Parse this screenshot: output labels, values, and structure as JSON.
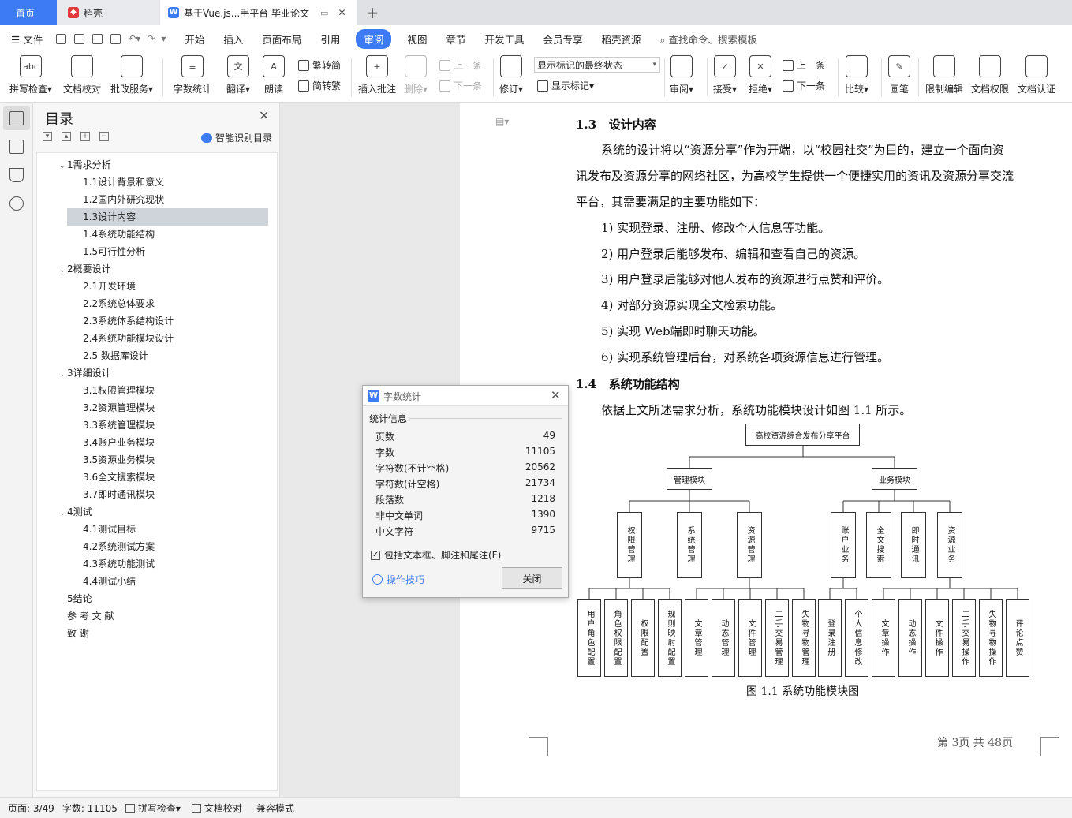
{
  "tabs": {
    "home": "首页",
    "daoke": "稻壳",
    "doc": "基于Vue.js...手平台 毕业论文",
    "add": "+"
  },
  "menu": {
    "file": "文件",
    "items": [
      "开始",
      "插入",
      "页面布局",
      "引用",
      "审阅",
      "视图",
      "章节",
      "开发工具",
      "会员专享",
      "稻壳资源"
    ],
    "active": "审阅",
    "search": "查找命令、搜索模板"
  },
  "ribbon": {
    "spell": "拼写检查",
    "proof": "文档校对",
    "batch": "批改服务",
    "count": "字数统计",
    "translate": "翻译",
    "read": "朗读",
    "to_trad": "繁转简",
    "to_simp": "简转繁",
    "insert_comment": "插入批注",
    "delete": "删除",
    "prev": "上一条",
    "next": "下一条",
    "revise": "修订",
    "markup_select": "显示标记的最终状态",
    "show_markup": "显示标记",
    "review": "审阅",
    "accept": "接受",
    "reject": "拒绝",
    "prev2": "上一条",
    "next2": "下一条",
    "compare": "比较",
    "pen": "画笔",
    "restrict": "限制编辑",
    "permission": "文档权限",
    "certify": "文档认证"
  },
  "nav": {
    "title": "目录",
    "smart": "智能识别目录",
    "items": [
      {
        "label": "1需求分析",
        "level": 1,
        "caret": true
      },
      {
        "label": "1.1设计背景和意义",
        "level": 2
      },
      {
        "label": "1.2国内外研究现状",
        "level": 2
      },
      {
        "label": "1.3设计内容",
        "level": 2,
        "selected": true
      },
      {
        "label": "1.4系统功能结构",
        "level": 2
      },
      {
        "label": "1.5可行性分析",
        "level": 2
      },
      {
        "label": "2概要设计",
        "level": 1,
        "caret": true
      },
      {
        "label": "2.1开发环境",
        "level": 2
      },
      {
        "label": "2.2系统总体要求",
        "level": 2
      },
      {
        "label": "2.3系统体系结构设计",
        "level": 2
      },
      {
        "label": "2.4系统功能模块设计",
        "level": 2
      },
      {
        "label": "2.5 数据库设计",
        "level": 2
      },
      {
        "label": "3详细设计",
        "level": 1,
        "caret": true
      },
      {
        "label": "3.1权限管理模块",
        "level": 2
      },
      {
        "label": "3.2资源管理模块",
        "level": 2
      },
      {
        "label": "3.3系统管理模块",
        "level": 2
      },
      {
        "label": "3.4账户业务模块",
        "level": 2
      },
      {
        "label": "3.5资源业务模块",
        "level": 2
      },
      {
        "label": "3.6全文搜索模块",
        "level": 2
      },
      {
        "label": "3.7即时通讯模块",
        "level": 2
      },
      {
        "label": "4测试",
        "level": 1,
        "caret": true
      },
      {
        "label": "4.1测试目标",
        "level": 2
      },
      {
        "label": "4.2系统测试方案",
        "level": 2
      },
      {
        "label": "4.3系统功能测试",
        "level": 2
      },
      {
        "label": "4.4测试小结",
        "level": 2
      },
      {
        "label": "5结论",
        "level": 1
      },
      {
        "label": "参 考 文 献",
        "level": 1
      },
      {
        "label": "致 谢",
        "level": 1
      }
    ]
  },
  "doc": {
    "h13_num": "1.3",
    "h13_title": "设计内容",
    "para1": [
      "系统的设计将以“资源分享”作为开端，以“校园社交”为目的，建立一个面向资",
      "讯发布及资源分享的网络社区，为高校学生提供一个便捷实用的资讯及资源分享交流",
      "平台，其需要满足的主要功能如下："
    ],
    "list": [
      "1)  实现登录、注册、修改个人信息等功能。",
      "2)  用户登录后能够发布、编辑和查看自己的资源。",
      "3)  用户登录后能够对他人发布的资源进行点赞和评价。",
      "4)  对部分资源实现全文检索功能。",
      "5)  实现 Web端即时聊天功能。",
      "6)  实现系统管理后台，对系统各项资源信息进行管理。"
    ],
    "h14_num": "1.4",
    "h14_title": "系统功能结构",
    "para2": "依据上文所述需求分析，系统功能模块设计如图  1.1 所示。",
    "caption": "图 1.1  系统功能模块图",
    "page_footer": "第 3页 共 48页"
  },
  "diagram": {
    "root": "高校资源综合发布分享平台",
    "l1": [
      "管理模块",
      "业务模块"
    ],
    "l2": [
      "权限管理",
      "系统管理",
      "资源管理",
      "账户业务",
      "全文搜索",
      "即时通讯",
      "资源业务"
    ],
    "l3": [
      "用户角色配置",
      "角色权限配置",
      "权限配置",
      "规则映射配置",
      "文章管理",
      "动态管理",
      "文件管理",
      "二手交易管理",
      "失物寻物管理",
      "登录注册",
      "个人信息修改",
      "文章操作",
      "动态操作",
      "文件操作",
      "二手交易操作",
      "失物寻物操作",
      "评论点赞"
    ]
  },
  "dialog": {
    "title": "字数统计",
    "section": "统计信息",
    "rows": [
      {
        "k": "页数",
        "v": "49"
      },
      {
        "k": "字数",
        "v": "11105"
      },
      {
        "k": "字符数(不计空格)",
        "v": "20562"
      },
      {
        "k": "字符数(计空格)",
        "v": "21734"
      },
      {
        "k": "段落数",
        "v": "1218"
      },
      {
        "k": "非中文单词",
        "v": "1390"
      },
      {
        "k": "中文字符",
        "v": "9715"
      }
    ],
    "checkbox": "包括文本框、脚注和尾注(F)",
    "tips": "操作技巧",
    "close": "关闭"
  },
  "status": {
    "page": "页面: 3/49",
    "words": "字数: 11105",
    "spell": "拼写检查",
    "proof": "文档校对",
    "compat": "兼容模式"
  },
  "colors": {
    "accent": "#3c7bf4"
  }
}
